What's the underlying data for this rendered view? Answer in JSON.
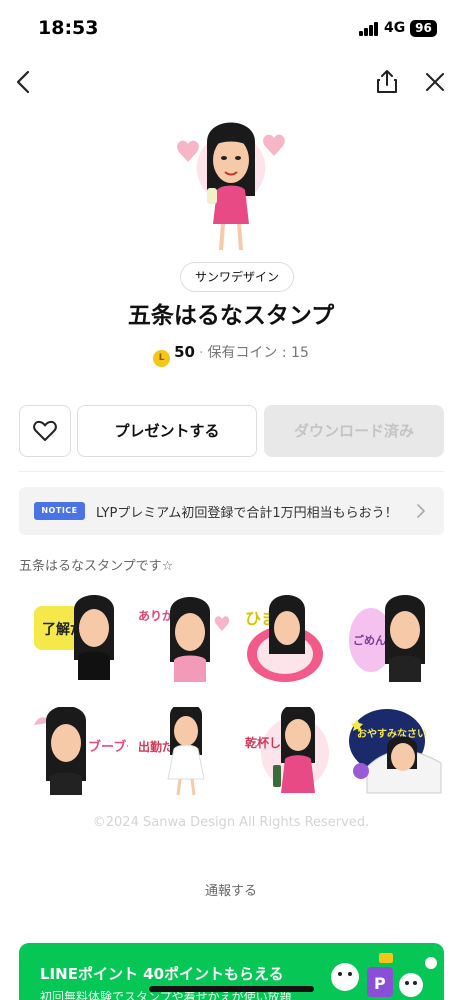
{
  "status_bar": {
    "time": "18:53",
    "network": "4G",
    "battery": "96"
  },
  "nav": {
    "back_icon": "chevron-left-icon",
    "share_icon": "share-icon",
    "close_icon": "close-icon"
  },
  "product": {
    "creator": "サンワデザイン",
    "title": "五条はるなスタンプ",
    "price_coin": "50",
    "coin_symbol": "L",
    "owned_coins": "保有コイン : 15"
  },
  "actions": {
    "gift_label": "プレゼントする",
    "download_label": "ダウンロード済み"
  },
  "notice": {
    "tag": "NOTICE",
    "text": "LYPプレミアム初回登録で合計1万円相当もらおう！"
  },
  "description": "五条はるなスタンプです☆",
  "stickers": [
    {
      "caption": "了解だにゃ"
    },
    {
      "caption": "ありがちょ"
    },
    {
      "caption": "ひま"
    },
    {
      "caption": "ごめんね"
    },
    {
      "caption": "ブーブー"
    },
    {
      "caption": "出勤だよん"
    },
    {
      "caption": "乾杯しよ"
    },
    {
      "caption": "おやすみなさい"
    }
  ],
  "copyright": "©2024 Sanwa Design All Rights Reserved.",
  "report_label": "通報する",
  "banner": {
    "title": "LINEポイント 40ポイントもらえる",
    "subtitle": "初回無料体験でスタンプや着せかえが使い放題"
  },
  "colors": {
    "line_green": "#06c755",
    "notice_blue": "#4a73e6",
    "coin_gold": "#f5c518"
  }
}
